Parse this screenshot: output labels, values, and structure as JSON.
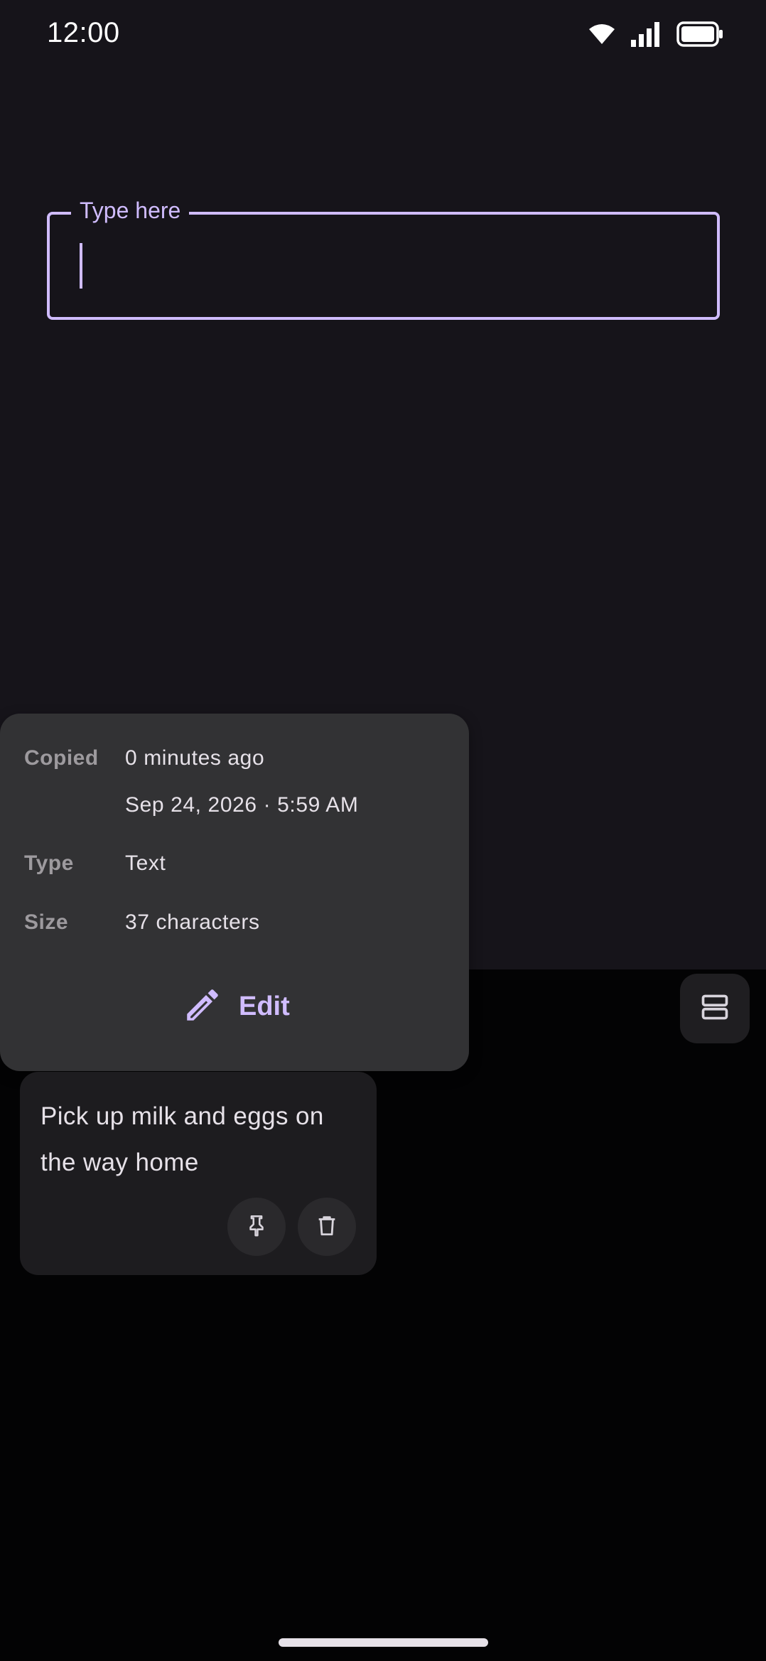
{
  "status_bar": {
    "time": "12:00",
    "icons": [
      "wifi-icon",
      "cellular-signal-icon",
      "battery-icon"
    ]
  },
  "input": {
    "label": "Type here",
    "value": ""
  },
  "details": {
    "copied_label": "Copied",
    "copied_relative": "0 minutes ago",
    "copied_datetime": "Sep 24, 2026 · 5:59 AM",
    "type_label": "Type",
    "type_value": "Text",
    "size_label": "Size",
    "size_value": "37 characters",
    "edit_label": "Edit",
    "edit_icon": "pencil-icon"
  },
  "layout_toggle": {
    "icon": "view-agenda-icon"
  },
  "clip": {
    "text": "Pick up milk and eggs on the way home",
    "actions": [
      "pin-icon",
      "delete-icon"
    ]
  },
  "colors": {
    "accent": "#d0bcff",
    "top_background": "#16141a",
    "bottom_background": "#030304",
    "popup_background": "#323234",
    "card_background": "#1d1c1f"
  }
}
